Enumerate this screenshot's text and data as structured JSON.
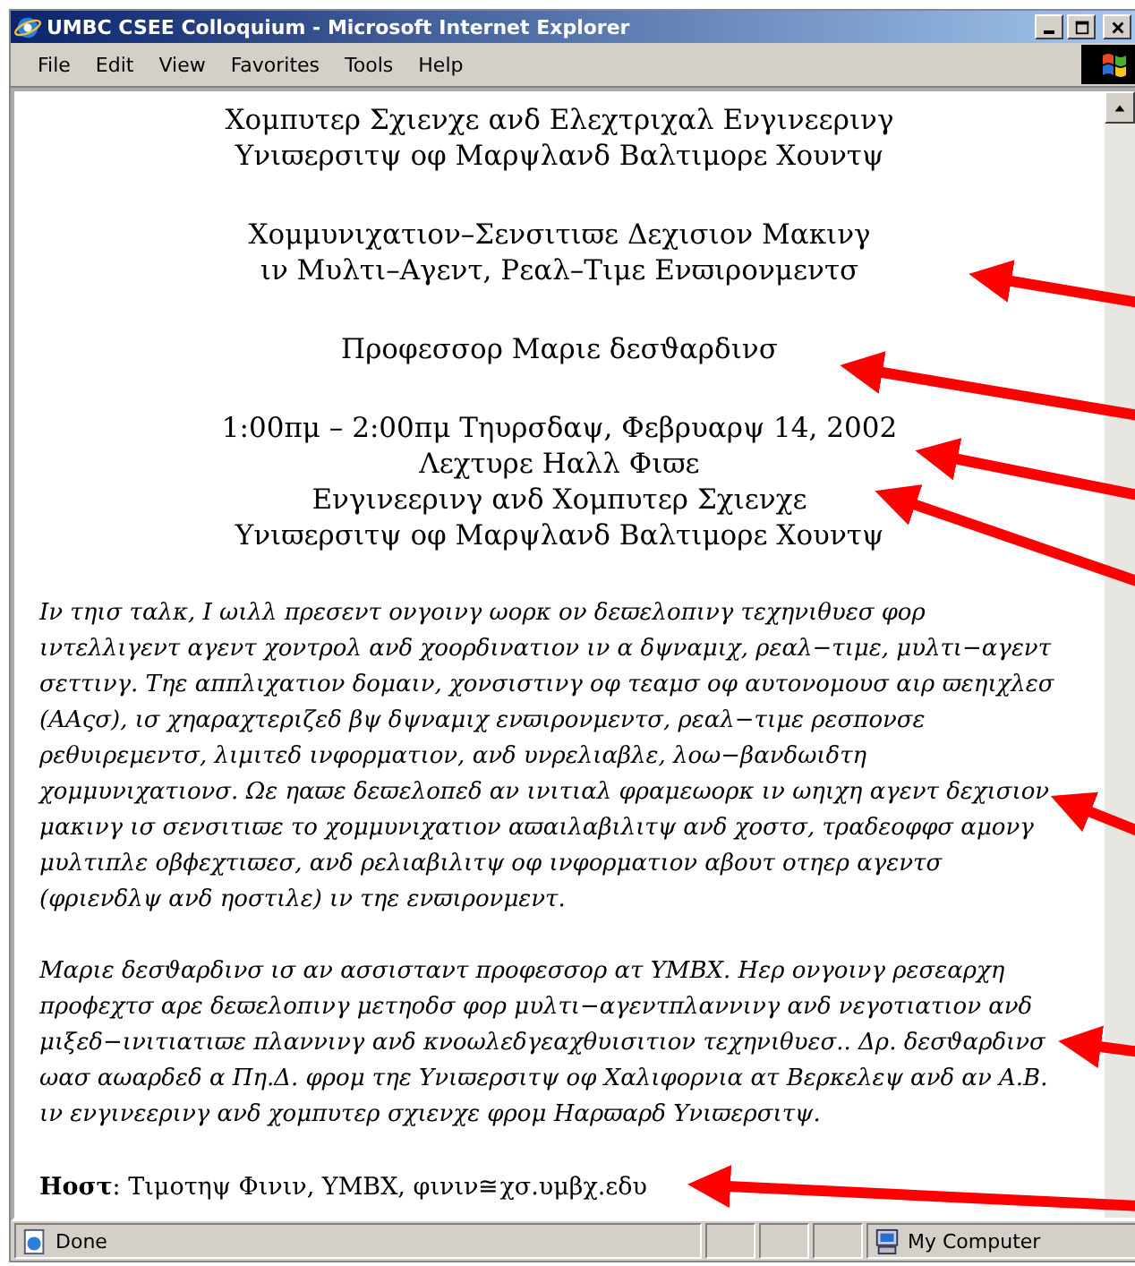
{
  "window": {
    "title": "UMBC CSEE Colloquium - Microsoft Internet Explorer"
  },
  "menu": [
    {
      "label": "File"
    },
    {
      "label": "Edit"
    },
    {
      "label": "View"
    },
    {
      "label": "Favorites"
    },
    {
      "label": "Tools"
    },
    {
      "label": "Help"
    }
  ],
  "content": [
    {
      "kind": "heading",
      "lines": [
        "Χομπυτερ Σχιενχε ανδ Ελεχτριχαλ Ενγινεερινγ",
        "Υνιϖερσιτψ οφ Μαρψλανδ Βαλτιμορε Χουντψ"
      ]
    },
    {
      "kind": "heading",
      "lines": [
        "Χομμυνιχατιον–Σενσιτιϖε Δεχισιον Μακινγ",
        "ιν Μυλτι–Αγεντ, Ρεαλ–Τιμε Ενϖιρονμεντσ"
      ]
    },
    {
      "kind": "heading",
      "lines": [
        "Προφεσσορ Μαριε δεσϑαρδινσ"
      ]
    },
    {
      "kind": "heading",
      "lines": [
        "1:00πμ – 2:00πμ Τηυρσδαψ, Φεβρυαρψ 14, 2002",
        "Λεχτυρε Ηαλλ Φιϖε",
        "Ενγινεερινγ ανδ Χομπυτερ Σχιενχε",
        "Υνιϖερσιτψ οφ Μαρψλανδ Βαλτιμορε Χουντψ"
      ]
    },
    {
      "kind": "paragraph",
      "text": "Ιν τηισ ταλκ, Ι ωιλλ πρεσεντ ονγοινγ ωορκ ον δεϖελοπινγ τεχηνιθυεσ φορ ιντελλιγεντ αγεντ χοντρολ ανδ χοορδινατιον ιν α δψναμιχ, ρεαλ−τιμε, μυλτι−αγεντ σεττινγ. Τηε αππλιχατιον δομαιν, χονσιστινγ οφ τεαμσ οφ αυτονομουσ αιρ ϖεηιχλεσ (ΑΑςσ), ισ χηαραχτεριζεδ βψ δψναμιχ ενϖιρονμεντσ, ρεαλ−τιμε ρεσπονσε ρεθυιρεμεντσ, λιμιτεδ ινφορματιον, ανδ υνρελιαβλε, λοω−βανδωιδτη χομμυνιχατιονσ. Ωε ηαϖε δεϖελοπεδ αν ινιτιαλ φραμεωορκ ιν ωηιχη αγεντ δεχισιον μακινγ ισ σενσιτιϖε το χομμυνιχατιον αϖαιλαβιλιτψ ανδ χοστσ, τραδεοφφσ αμονγ μυλτιπλε οβϕεχτιϖεσ, ανδ ρελιαβιλιτψ οφ ινφορματιον αβουτ οτηερ αγεντσ (φριενδλψ ανδ ηοστιλε) ιν τηε ενϖιρονμεντ."
    },
    {
      "kind": "paragraph",
      "text": "Μαριε δεσϑαρδινσ ισ αν ασσισταντ προφεσσορ ατ ΥΜΒΧ. Ηερ ονγοινγ ρεσεαρχη προϕεχτσ αρε δεϖελοπινγ μετηοδσ φορ μυλτι−αγεντπλαννινγ ανδ νεγοτιατιον ανδ μιξεδ−ινιτιατιϖε πλαννινγ ανδ κνοωλεδγεαχθυισιτιον τεχηνιθυεσ.. Δρ. δεσϑαρδινσ ωασ αωαρδεδ α Πη.Δ. φρομ τηε Υνιϖερσιτψ οφ Χαλιφορνια ατ Βερκελεψ ανδ αν Α.Β. ιν ενγινεερινγ ανδ χομπυτερ σχιενχε φρομ Ηαρϖαρδ Υνιϖερσιτψ."
    },
    {
      "kind": "host",
      "text": "**Ηοστ**: Τιμοτηψ Φινιν, ΥΜΒΧ, φινιν≅χσ.υμβχ.εδυ"
    }
  ],
  "status_bar": {
    "text": "Done",
    "zone": "My Computer"
  }
}
